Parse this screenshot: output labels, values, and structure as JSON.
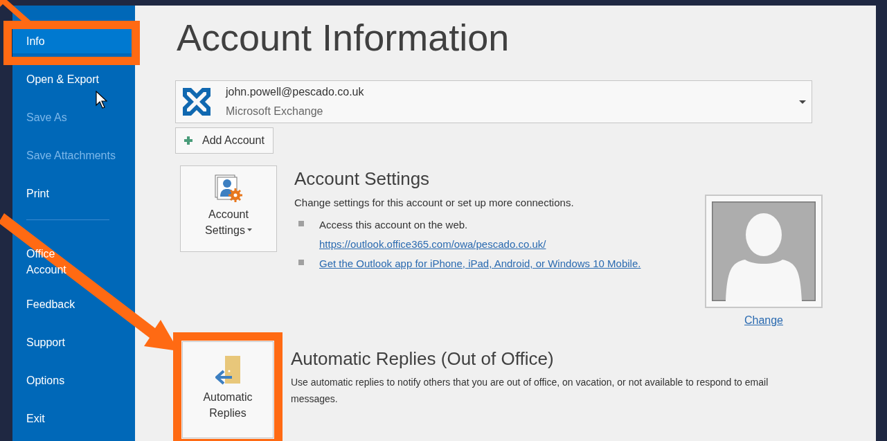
{
  "sidebar": {
    "items": [
      {
        "kind": "item",
        "label": "Info",
        "selected": true,
        "disabled": false,
        "highlighted": true
      },
      {
        "kind": "item",
        "label": "Open & Export",
        "selected": false,
        "disabled": false,
        "highlighted": false
      },
      {
        "kind": "item",
        "label": "Save As",
        "selected": false,
        "disabled": true,
        "highlighted": false
      },
      {
        "kind": "item",
        "label": "Save Attachments",
        "selected": false,
        "disabled": true,
        "highlighted": false
      },
      {
        "kind": "item",
        "label": "Print",
        "selected": false,
        "disabled": false,
        "highlighted": false
      },
      {
        "kind": "divider"
      },
      {
        "kind": "item",
        "label": "Office\nAccount",
        "selected": false,
        "disabled": false,
        "highlighted": false
      },
      {
        "kind": "item",
        "label": "Feedback",
        "selected": false,
        "disabled": false,
        "highlighted": false
      },
      {
        "kind": "item",
        "label": "Support",
        "selected": false,
        "disabled": false,
        "highlighted": false
      },
      {
        "kind": "item",
        "label": "Options",
        "selected": false,
        "disabled": false,
        "highlighted": false
      },
      {
        "kind": "item",
        "label": "Exit",
        "selected": false,
        "disabled": false,
        "highlighted": false
      }
    ]
  },
  "page": {
    "title": "Account Information"
  },
  "account": {
    "email": "john.powell@pescado.co.uk",
    "type": "Microsoft Exchange"
  },
  "add_account": {
    "label": "Add Account"
  },
  "account_settings": {
    "button_label": "Account Settings",
    "heading": "Account Settings",
    "description": "Change settings for this account or set up more connections.",
    "bullets": [
      {
        "kind": "text",
        "text": "Access this account on the web.",
        "link": "https://outlook.office365.com/owa/pescado.co.uk/"
      },
      {
        "kind": "link",
        "text": "Get the Outlook app for iPhone, iPad, Android, or Windows 10 Mobile."
      }
    ],
    "photo_link": "Change"
  },
  "automatic_replies": {
    "button_label": "Automatic Replies",
    "heading": "Automatic Replies (Out of Office)",
    "description": "Use automatic replies to notify others that you are out of office, on vacation, or not available to respond to email messages.",
    "highlighted": true
  }
}
